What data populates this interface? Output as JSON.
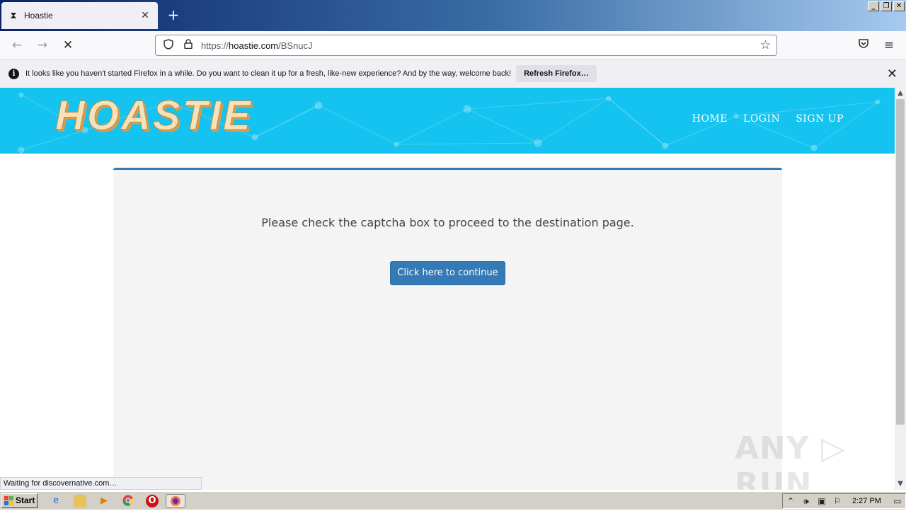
{
  "browser": {
    "tab": {
      "title": "Hoastie",
      "favicon": "hourglass-icon",
      "close_glyph": "✕"
    },
    "new_tab_glyph": "+",
    "window_controls": [
      "_",
      "❐",
      "✕"
    ],
    "nav": {
      "back_glyph": "←",
      "forward_glyph": "→",
      "stop_glyph": "✕"
    },
    "url": {
      "prefix": "https://",
      "host": "hoastie.com",
      "path": "/BSnucJ"
    },
    "menu_glyph": "≡",
    "notification": {
      "message": "It looks like you haven't started Firefox in a while. Do you want to clean it up for a fresh, like-new experience? And by the way, welcome back!",
      "button": "Refresh Firefox…",
      "close_glyph": "✕"
    },
    "status": "Waiting for discovernative.com…"
  },
  "site": {
    "logo": "HOASTIE",
    "nav": [
      "HOME",
      "LOGIN",
      "SIGN UP"
    ],
    "prompt": "Please check the captcha box to proceed to the destination page.",
    "continue_button": "Click here to continue",
    "brand_color": "#14c3ef",
    "button_color": "#337ab7"
  },
  "watermark": "ANY ▷ RUN",
  "taskbar": {
    "start": "Start",
    "clock": "2:27 PM"
  }
}
